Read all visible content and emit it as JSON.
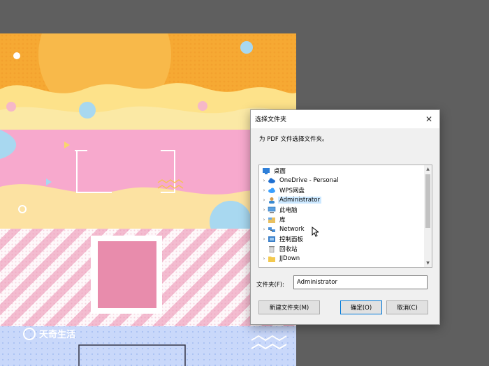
{
  "dialog": {
    "title": "选择文件夹",
    "close_glyph": "✕",
    "prompt": "为 PDF 文件选择文件夹。",
    "tree": [
      {
        "label": "桌面",
        "icon": "desktop-icon",
        "expandable": false,
        "indent": 0,
        "selected": false
      },
      {
        "label": "OneDrive - Personal",
        "icon": "cloud-icon",
        "expandable": true,
        "indent": 1,
        "selected": false
      },
      {
        "label": "WPS网盘",
        "icon": "cloud-drive-icon",
        "expandable": true,
        "indent": 1,
        "selected": false
      },
      {
        "label": "Administrator",
        "icon": "user-icon",
        "expandable": true,
        "indent": 1,
        "selected": true
      },
      {
        "label": "此电脑",
        "icon": "computer-icon",
        "expandable": true,
        "indent": 1,
        "selected": false
      },
      {
        "label": "库",
        "icon": "library-icon",
        "expandable": true,
        "indent": 1,
        "selected": false
      },
      {
        "label": "Network",
        "icon": "network-icon",
        "expandable": true,
        "indent": 1,
        "selected": false
      },
      {
        "label": "控制面板",
        "icon": "control-panel-icon",
        "expandable": true,
        "indent": 1,
        "selected": false
      },
      {
        "label": "回收站",
        "icon": "recycle-bin-icon",
        "expandable": false,
        "indent": 1,
        "selected": false
      },
      {
        "label": "JJDown",
        "icon": "folder-icon",
        "expandable": true,
        "indent": 1,
        "selected": false
      }
    ],
    "folder_label": "文件夹(F):",
    "folder_value": "Administrator",
    "new_folder_label": "新建文件夹(M)",
    "ok_label": "确定(O)",
    "cancel_label": "取消(C)"
  },
  "watermark": "天奇生活",
  "colors": {
    "selection": "#cce8ff",
    "primary_border": "#0078d7",
    "desktop_blue": "#2f7fd8"
  }
}
